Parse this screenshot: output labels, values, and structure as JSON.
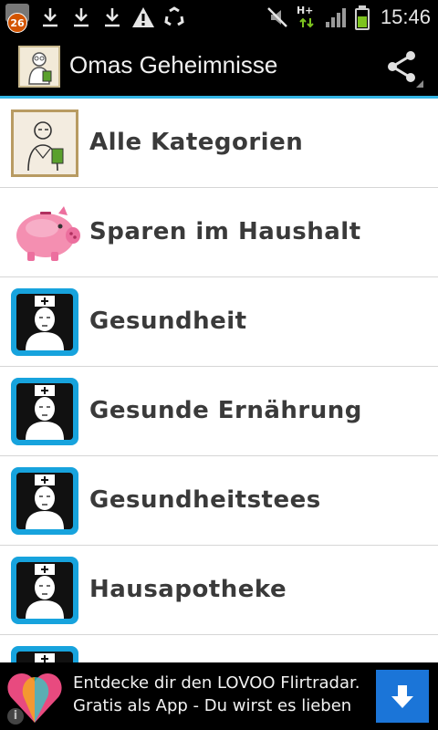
{
  "status_bar": {
    "notification_count": "26",
    "time": "15:46",
    "network_label": "H+",
    "battery_level": 0.6,
    "icons": [
      "notification-icon",
      "download-icon",
      "download-icon",
      "download-icon",
      "warning-icon",
      "recycle-icon",
      "mute-icon",
      "network-icon",
      "signal-icon",
      "battery-icon"
    ]
  },
  "action_bar": {
    "title": "Omas Geheimnisse",
    "icon": "app-icon",
    "share_icon": "share-icon"
  },
  "categories": [
    {
      "label": "Alle Kategorien",
      "icon": "grandma-sketch-icon"
    },
    {
      "label": "Sparen im Haushalt",
      "icon": "piggy-bank-icon"
    },
    {
      "label": "Gesundheit",
      "icon": "nurse-icon"
    },
    {
      "label": "Gesunde Ernährung",
      "icon": "nurse-icon"
    },
    {
      "label": "Gesundheitstees",
      "icon": "nurse-icon"
    },
    {
      "label": "Hausapotheke",
      "icon": "nurse-icon"
    },
    {
      "label": "",
      "icon": "nurse-icon"
    }
  ],
  "ad": {
    "line1": "Entdecke dir den LOVOO Flirtradar.",
    "line2": "Gratis als App - Du wirst es lieben",
    "download_icon": "download-arrow-icon",
    "info_icon": "info-icon"
  },
  "colors": {
    "accent": "#33b5e5",
    "icon_blue": "#17a3dd",
    "ad_button": "#1b75d8",
    "battery_green": "#7dc31f"
  }
}
